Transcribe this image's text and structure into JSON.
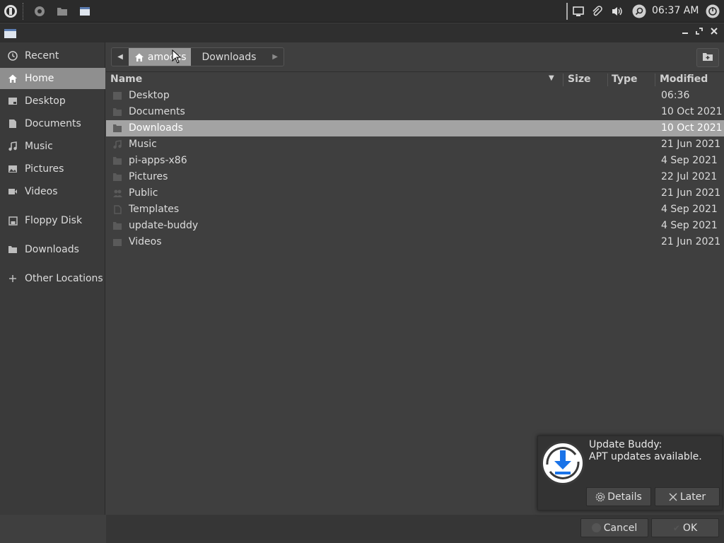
{
  "panel": {
    "clock": "06:37 AM",
    "icons": [
      "app-menu-icon",
      "firefox-icon",
      "files-icon",
      "window-icon",
      "screen-icon",
      "paperclip-icon",
      "volume-icon",
      "search-icon",
      "power-icon"
    ]
  },
  "sidebar": {
    "items": [
      {
        "label": "Recent",
        "icon": "clock-icon"
      },
      {
        "label": "Home",
        "icon": "home-icon"
      },
      {
        "label": "Desktop",
        "icon": "desktop-icon"
      },
      {
        "label": "Documents",
        "icon": "document-icon"
      },
      {
        "label": "Music",
        "icon": "music-icon"
      },
      {
        "label": "Pictures",
        "icon": "picture-icon"
      },
      {
        "label": "Videos",
        "icon": "video-icon"
      },
      {
        "label": "Floppy Disk",
        "icon": "floppy-icon"
      },
      {
        "label": "Downloads",
        "icon": "folder-icon"
      },
      {
        "label": "Other Locations",
        "icon": "plus-icon"
      }
    ]
  },
  "pathbar": {
    "home_label": "amocus",
    "current_label": "Downloads"
  },
  "columns": {
    "name": "Name",
    "size": "Size",
    "type": "Type",
    "modified": "Modified"
  },
  "files": [
    {
      "name": "Desktop",
      "modified": "06:36"
    },
    {
      "name": "Documents",
      "modified": "10 Oct 2021"
    },
    {
      "name": "Downloads",
      "modified": "10 Oct 2021"
    },
    {
      "name": "Music",
      "modified": "21 Jun 2021"
    },
    {
      "name": "pi-apps-x86",
      "modified": "4 Sep 2021"
    },
    {
      "name": "Pictures",
      "modified": "22 Jul 2021"
    },
    {
      "name": "Public",
      "modified": "21 Jun 2021"
    },
    {
      "name": "Templates",
      "modified": "4 Sep 2021"
    },
    {
      "name": "update-buddy",
      "modified": "4 Sep 2021"
    },
    {
      "name": "Videos",
      "modified": "21 Jun 2021"
    }
  ],
  "buttons": {
    "cancel": "Cancel",
    "ok": "OK"
  },
  "notification": {
    "title": "Update Buddy:",
    "body": "APT updates available.",
    "details": "Details",
    "later": "Later"
  },
  "colors": {
    "selection": "#a3a3a3",
    "sidebar_active": "#8f8f8f",
    "accent_blue": "#1a73e8"
  }
}
